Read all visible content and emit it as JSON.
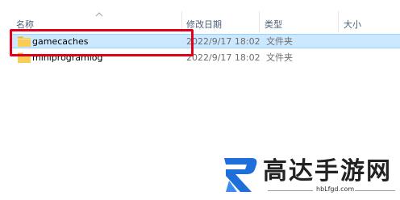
{
  "header": {
    "columns": [
      {
        "label": "名称"
      },
      {
        "label": "修改日期"
      },
      {
        "label": "类型"
      },
      {
        "label": "大小"
      }
    ]
  },
  "files": [
    {
      "name": "gamecaches",
      "modified": "2022/9/17 18:02",
      "type": "文件夹",
      "selected": true,
      "icon": "folder-icon"
    },
    {
      "name": "miniprogramlog",
      "modified": "2022/9/17 18:02",
      "type": "文件夹",
      "selected": false,
      "icon": "folder-icon"
    }
  ],
  "watermark": {
    "text": "高达手游网",
    "url": "hbLfgd.com"
  },
  "colors": {
    "selection_bg": "#cce8ff",
    "highlight_border": "#e0001b",
    "logo_blue": "#1e6fd9"
  }
}
